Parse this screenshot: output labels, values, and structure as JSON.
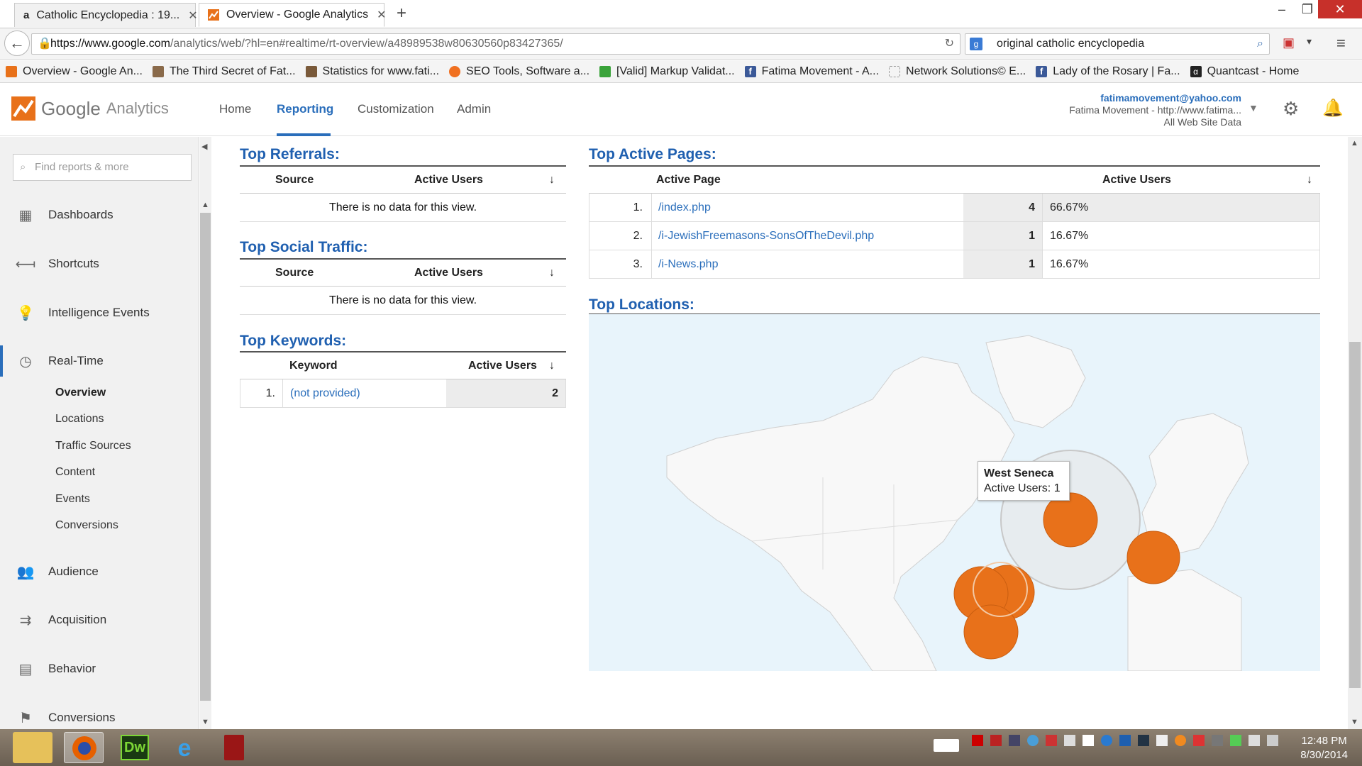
{
  "browser": {
    "tabs": [
      {
        "label": "Catholic Encyclopedia : 19...",
        "icon": "amazon-icon",
        "active": false
      },
      {
        "label": "Overview - Google Analytics",
        "icon": "analytics-icon",
        "active": true
      }
    ],
    "url_host": "https://www.google.com",
    "url_path": "/analytics/web/?hl=en#realtime/rt-overview/a48989538w80630560p83427365/",
    "search_text": "original catholic encyclopedia",
    "bookmarks": [
      {
        "label": "Overview - Google An...",
        "color": "#e8711a"
      },
      {
        "label": "The Third Secret of Fat...",
        "color": "#8a6a4a"
      },
      {
        "label": "Statistics for www.fati...",
        "color": "#7a5a3a"
      },
      {
        "label": "SEO Tools, Software a...",
        "color": "#f07020"
      },
      {
        "label": "[Valid] Markup Validat...",
        "color": "#3aa33a"
      },
      {
        "label": "Fatima Movement - A...",
        "color": "#3b5998"
      },
      {
        "label": "Network Solutions© E...",
        "color": "#dddddd"
      },
      {
        "label": "Lady of the Rosary | Fa...",
        "color": "#3b5998"
      },
      {
        "label": "Quantcast - Home",
        "color": "#222222"
      }
    ]
  },
  "ga": {
    "logo_google": "Google",
    "logo_analytics": "Analytics",
    "nav": [
      "Home",
      "Reporting",
      "Customization",
      "Admin"
    ],
    "account_email": "fatimamovement@yahoo.com",
    "account_property": "Fatima Movement - http://www.fatima...",
    "account_view": "All Web Site Data"
  },
  "sidebar": {
    "search_placeholder": "Find reports & more",
    "items": [
      {
        "label": "Dashboards",
        "icon": "grid-icon"
      },
      {
        "label": "Shortcuts",
        "icon": "shortcut-arrow-icon"
      },
      {
        "label": "Intelligence Events",
        "icon": "lightbulb-icon"
      },
      {
        "label": "Real-Time",
        "icon": "clock-icon"
      },
      {
        "label": "Audience",
        "icon": "people-icon"
      },
      {
        "label": "Acquisition",
        "icon": "acquisition-icon"
      },
      {
        "label": "Behavior",
        "icon": "behavior-icon"
      },
      {
        "label": "Conversions",
        "icon": "flag-icon"
      }
    ],
    "realtime_sub": [
      "Overview",
      "Locations",
      "Traffic Sources",
      "Content",
      "Events",
      "Conversions"
    ]
  },
  "main": {
    "referrals": {
      "title": "Top Referrals:",
      "col1": "Source",
      "col2": "Active Users",
      "empty": "There is no data for this view."
    },
    "social": {
      "title": "Top Social Traffic:",
      "col1": "Source",
      "col2": "Active Users",
      "empty": "There is no data for this view."
    },
    "keywords": {
      "title": "Top Keywords:",
      "col1": "Keyword",
      "col2": "Active Users",
      "rows": [
        {
          "rank": "1.",
          "keyword": "(not provided)",
          "users": "2"
        }
      ]
    },
    "pages": {
      "title": "Top Active Pages:",
      "col1": "Active Page",
      "col2": "Active Users",
      "rows": [
        {
          "rank": "1.",
          "page": "/index.php",
          "users": "4",
          "pct": "66.67%"
        },
        {
          "rank": "2.",
          "page": "/i-JewishFreemasons-SonsOfTheDevil.php",
          "users": "1",
          "pct": "16.67%"
        },
        {
          "rank": "3.",
          "page": "/i-News.php",
          "users": "1",
          "pct": "16.67%"
        }
      ]
    },
    "locations": {
      "title": "Top Locations:",
      "tooltip_city": "West Seneca",
      "tooltip_value": "Active Users: 1"
    }
  },
  "taskbar": {
    "time": "12:48 PM",
    "date": "8/30/2014"
  }
}
